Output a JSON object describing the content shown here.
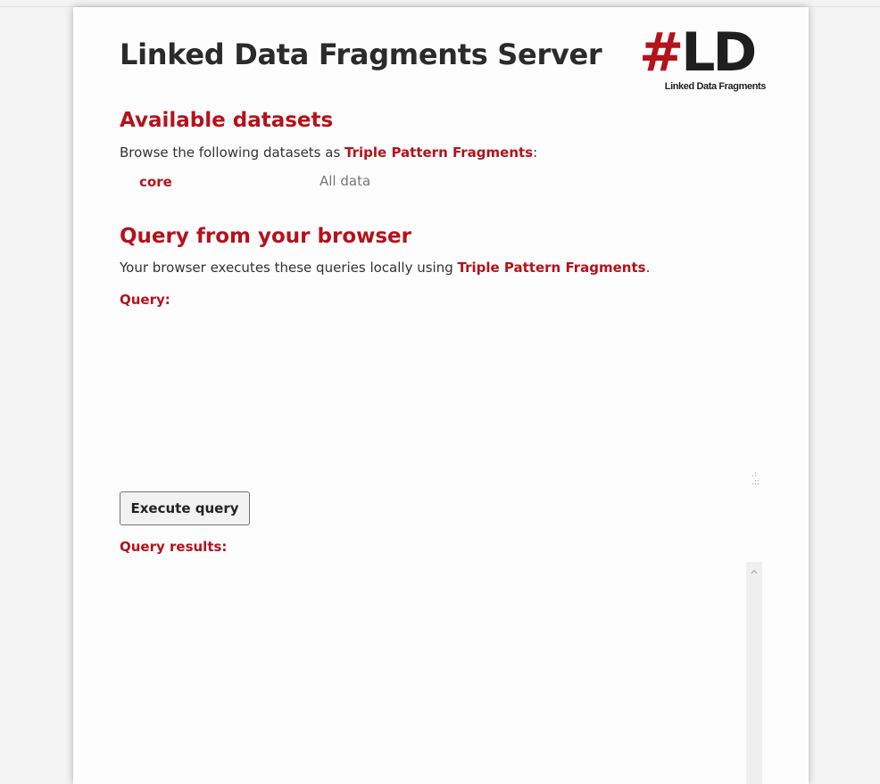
{
  "header": {
    "title": "Linked Data Fragments Server",
    "logo": {
      "mark_hash": "#",
      "mark_letters": "LD",
      "caption": "Linked Data Fragments"
    }
  },
  "datasets_section": {
    "heading": "Available datasets",
    "intro_prefix": "Browse the following datasets as ",
    "intro_link": "Triple Pattern Fragments",
    "intro_suffix": ":",
    "items": [
      {
        "name": "core",
        "description": "All data"
      }
    ]
  },
  "query_section": {
    "heading": "Query from your browser",
    "intro_prefix": "Your browser executes these queries locally using ",
    "intro_link": "Triple Pattern Fragments",
    "intro_suffix": ".",
    "query_label": "Query:",
    "query_value": "",
    "execute_button": "Execute query",
    "results_label": "Query results:",
    "results_value": ""
  },
  "colors": {
    "accent": "#b5121b",
    "title_text": "#2b2b2b",
    "body_text": "#333333",
    "muted_text": "#777777",
    "page_background": "#fdfdfd",
    "outer_background": "#f3f3f3"
  }
}
